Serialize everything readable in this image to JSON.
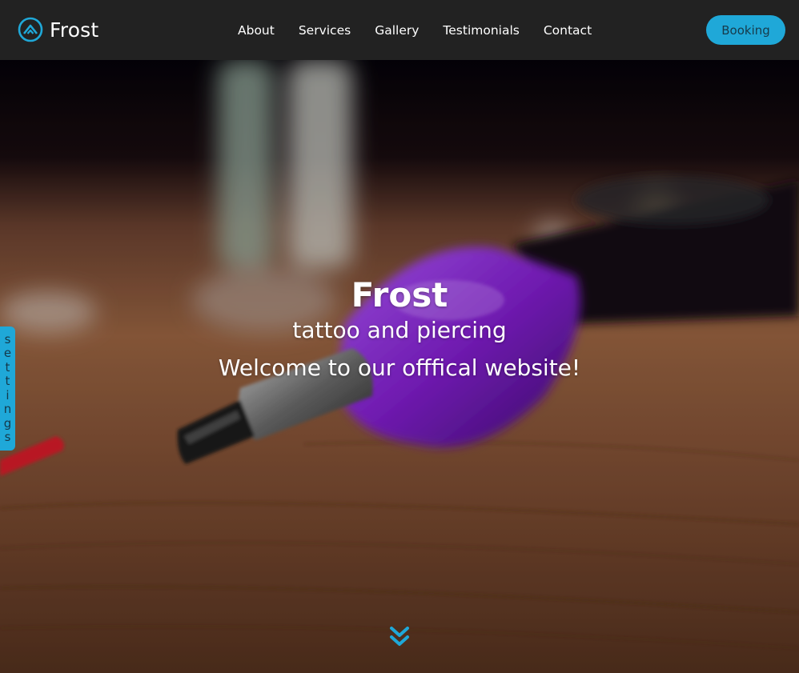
{
  "brand": {
    "name": "Frost",
    "logo_icon": "mountain-icon",
    "accent_color": "#1fa8d8"
  },
  "nav": {
    "links": [
      "About",
      "Services",
      "Gallery",
      "Testimonials",
      "Contact"
    ],
    "booking_label": "Booking"
  },
  "hero": {
    "title": "Frost",
    "subtitle": "tattoo and piercing",
    "welcome": "Welcome to our offfical website!",
    "scroll_icon": "double-chevron-down-icon"
  },
  "settings": {
    "label": "settings"
  }
}
